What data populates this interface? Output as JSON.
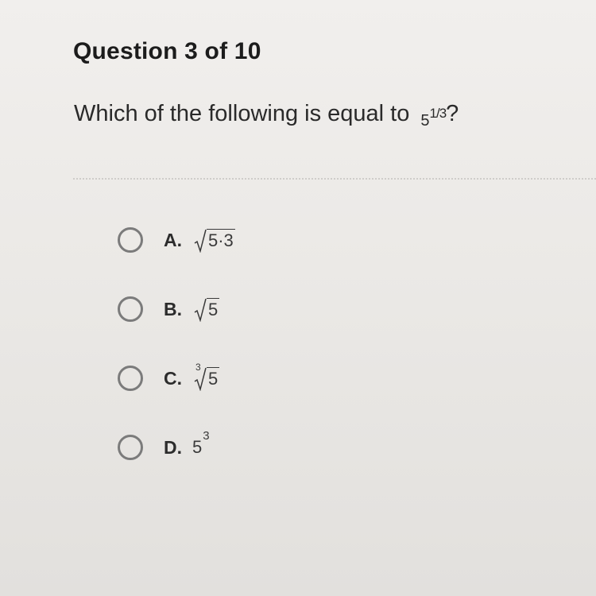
{
  "header": {
    "question_label": "Question 3 of 10"
  },
  "question": {
    "prompt_text": "Which of the following is equal to",
    "expr_base": "5",
    "expr_exponent": "1/3",
    "question_mark": "?"
  },
  "options": [
    {
      "letter": "A.",
      "radicand": "5·3",
      "index": "",
      "kind": "sqrt"
    },
    {
      "letter": "B.",
      "radicand": "5",
      "index": "",
      "kind": "sqrt"
    },
    {
      "letter": "C.",
      "radicand": "5",
      "index": "3",
      "kind": "root"
    },
    {
      "letter": "D.",
      "base": "5",
      "exponent": "3",
      "kind": "power"
    }
  ],
  "colors": {
    "background": "#ebe9e6",
    "text": "#262626",
    "radio_border": "#7b7b7b",
    "divider": "#cfcdca"
  }
}
